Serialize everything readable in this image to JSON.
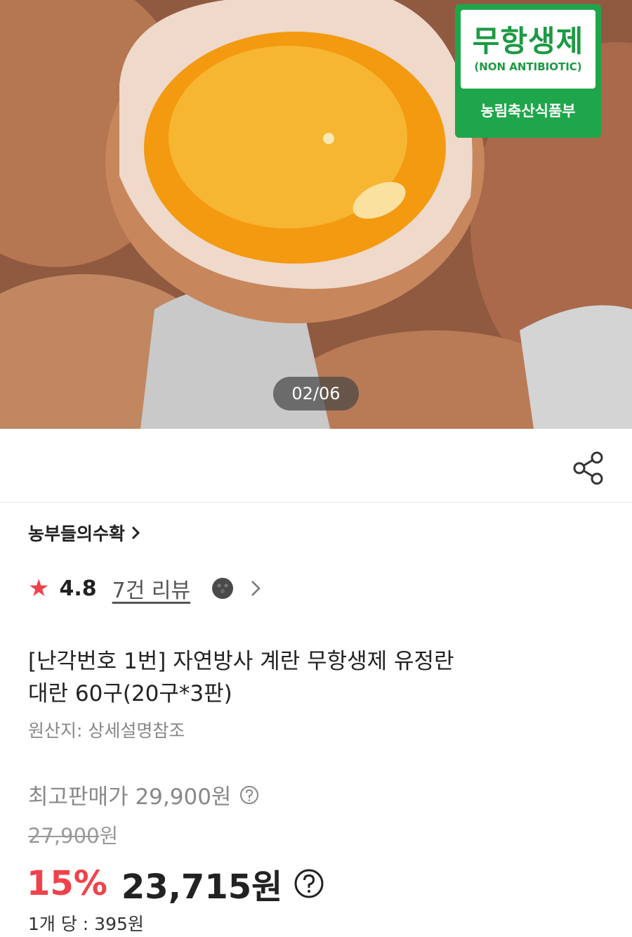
{
  "gallery": {
    "counter": "02/06",
    "badge": {
      "main": "무항생제",
      "sub": "(NON ANTIBIOTIC)",
      "foot": "농림축산식품부"
    }
  },
  "share_icon": "share-icon",
  "seller": {
    "name": "농부들의수확"
  },
  "rating": {
    "score": "4.8",
    "reviews": "7건 리뷰",
    "star_color": "#f0424b"
  },
  "product": {
    "title_line1": "[난각번호 1번] 자연방사 계란 무항생제 유정란",
    "title_line2": "대란 60구(20구*3판)",
    "origin": "원산지: 상세설명참조"
  },
  "pricing": {
    "max_price": "최고판매가 29,900원",
    "original_price": "27,900",
    "original_unit": "원",
    "discount": "15%",
    "final_price": "23,715원",
    "unit_price": "1개 당 : 395원",
    "accent_color": "#f0424b"
  }
}
